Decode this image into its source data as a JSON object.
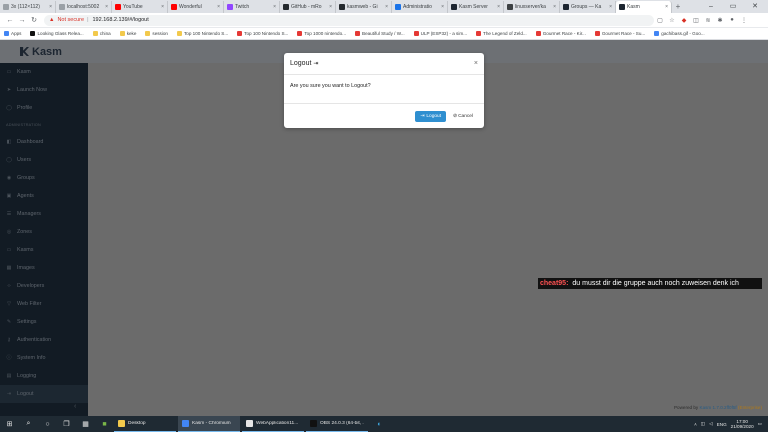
{
  "browser": {
    "tabs": [
      {
        "label": "3x (112×112)",
        "color": "#9aa0a6"
      },
      {
        "label": "localhost:5002",
        "color": "#9aa0a6"
      },
      {
        "label": "YouTube",
        "color": "#ff0000"
      },
      {
        "label": "Wonderful",
        "color": "#ff0000"
      },
      {
        "label": "Twitch",
        "color": "#9146ff"
      },
      {
        "label": "GitHub - mRo",
        "color": "#24292e"
      },
      {
        "label": "kasmweb - Gi",
        "color": "#24292e"
      },
      {
        "label": "Administratio",
        "color": "#1a73e8"
      },
      {
        "label": "Kasm Server",
        "color": "#1c2530"
      },
      {
        "label": "linuxserver/ka",
        "color": "#3c4043"
      },
      {
        "label": "Groups — Ka",
        "color": "#1c2530"
      },
      {
        "label": "Kasm",
        "color": "#1c2530"
      }
    ],
    "active_tab_index": 11,
    "address": {
      "warning": "Not secure",
      "url": "192.168.2.139/#/logout"
    },
    "bookmarks": [
      {
        "label": "Apps",
        "color": "#4285f4"
      },
      {
        "label": "Looking Glass Relea...",
        "color": "#111111"
      },
      {
        "label": "china",
        "color": "#f2c94c"
      },
      {
        "label": "keke",
        "color": "#f2c94c"
      },
      {
        "label": "session",
        "color": "#f2c94c"
      },
      {
        "label": "Top 100 Nintendo S...",
        "color": "#f2c94c"
      },
      {
        "label": "Top 100 Nintendo S...",
        "color": "#e53935"
      },
      {
        "label": "Top 1000 nintendo...",
        "color": "#e53935"
      },
      {
        "label": "Beautiful Study / W...",
        "color": "#e53935"
      },
      {
        "label": "ULP (ESP32) - a sim...",
        "color": "#e53935"
      },
      {
        "label": "The Legend of Zeld...",
        "color": "#e53935"
      },
      {
        "label": "Gourmet Race - Kir...",
        "color": "#e53935"
      },
      {
        "label": "Gourmet Race - Su...",
        "color": "#e53935"
      },
      {
        "label": "gachibass.gif - Goo...",
        "color": "#4285f4"
      }
    ]
  },
  "app": {
    "logo_text": "Kasm",
    "sidebar": {
      "top_items": [
        {
          "label": "Kasm",
          "icon": "monitor-icon",
          "glyph": "▭"
        },
        {
          "label": "Launch Now",
          "icon": "rocket-icon",
          "glyph": "➤"
        },
        {
          "label": "Profile",
          "icon": "user-icon",
          "glyph": "◯"
        }
      ],
      "section_label": "ADMINISTRATION",
      "admin_items": [
        {
          "label": "Dashboard",
          "icon": "dashboard-icon",
          "glyph": "◧"
        },
        {
          "label": "Users",
          "icon": "users-icon",
          "glyph": "◯"
        },
        {
          "label": "Groups",
          "icon": "groups-icon",
          "glyph": "◉"
        },
        {
          "label": "Agents",
          "icon": "agents-icon",
          "glyph": "▣"
        },
        {
          "label": "Managers",
          "icon": "managers-icon",
          "glyph": "☰"
        },
        {
          "label": "Zones",
          "icon": "zones-icon",
          "glyph": "◎"
        },
        {
          "label": "Kasms",
          "icon": "kasms-icon",
          "glyph": "▭"
        },
        {
          "label": "Images",
          "icon": "images-icon",
          "glyph": "▦"
        },
        {
          "label": "Developers",
          "icon": "developers-icon",
          "glyph": "‹›"
        },
        {
          "label": "Web Filter",
          "icon": "filter-icon",
          "glyph": "▽"
        },
        {
          "label": "Settings",
          "icon": "settings-icon",
          "glyph": "✎"
        },
        {
          "label": "Authentication",
          "icon": "key-icon",
          "glyph": "⚷"
        },
        {
          "label": "System Info",
          "icon": "info-icon",
          "glyph": "ⓘ"
        },
        {
          "label": "Logging",
          "icon": "logging-icon",
          "glyph": "▤"
        },
        {
          "label": "Logout",
          "icon": "logout-icon",
          "glyph": "⇥"
        }
      ],
      "active_label": "Logout"
    },
    "footer": {
      "prefix": "Powered by",
      "link": "Kasm",
      "version": "1.7.0.2ff0f5f",
      "edition": "(Enterprise)"
    }
  },
  "modal": {
    "title": "Logout",
    "message": "Are you sure you want to Logout?",
    "confirm_label": "Logout",
    "cancel_label": "Cancel"
  },
  "chat": {
    "user": "cheat95:",
    "message": "du musst dir die gruppe auch noch zuweisen denk ich"
  },
  "taskbar": {
    "apps": [
      {
        "label": "Desktop",
        "color": "#f2c94c",
        "active": false
      },
      {
        "label": "Kasm - Chromium",
        "color": "#4285f4",
        "active": true
      },
      {
        "label": "WebApplication11...",
        "color": "#e6e6e6",
        "active": false
      },
      {
        "label": "OBS 24.0.3 (64-bit, ...",
        "color": "#111111",
        "active": false
      }
    ],
    "language": "ENG",
    "time": "17:00",
    "date": "21/09/2020"
  }
}
